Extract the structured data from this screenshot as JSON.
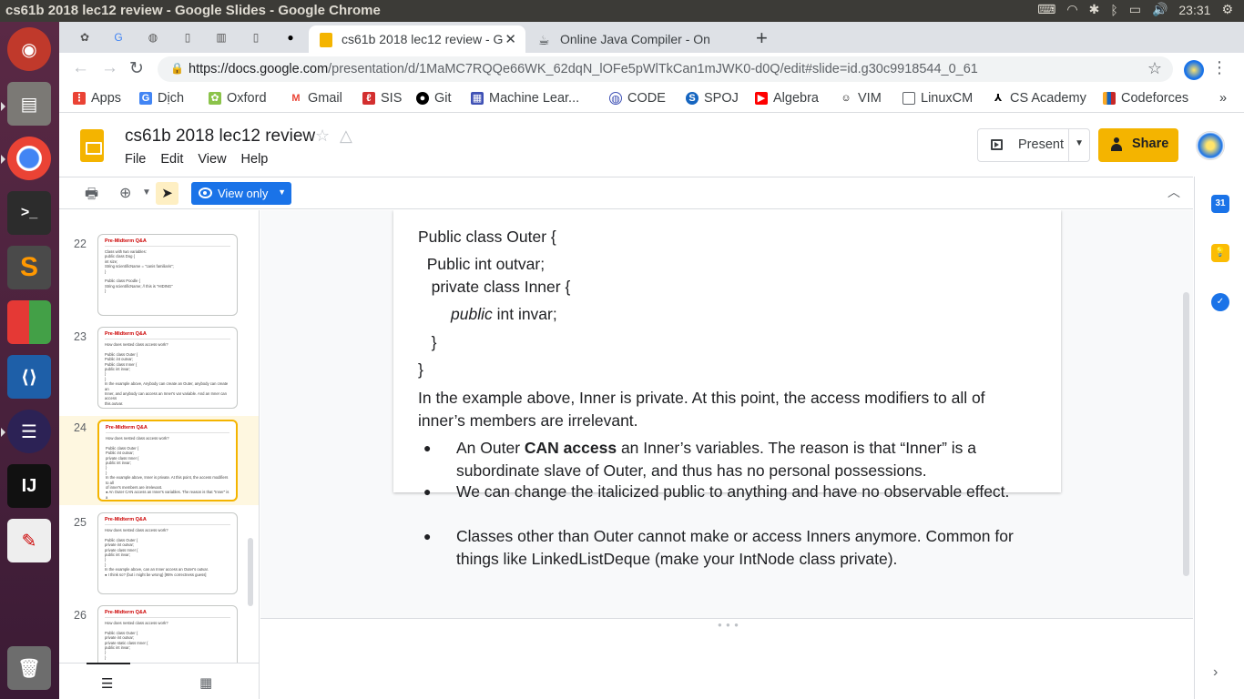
{
  "os": {
    "window_title": "cs61b 2018 lec12 review - Google Slides - Google Chrome",
    "clock": "23:31"
  },
  "browser": {
    "tabs": [
      {
        "label": "cs61b 2018 lec12 review - G",
        "active": true
      },
      {
        "label": "Online Java Compiler - On",
        "active": false
      }
    ],
    "url_host": "https://docs.google.com",
    "url_path": "/presentation/d/1MaMC7RQQe66WK_62dqN_lOFe5pWlTkCan1mJWK0-d0Q/edit#slide=id.g30c9918544_0_61",
    "bookmarks": [
      "Apps",
      "Dịch",
      "Oxford",
      "Gmail",
      "SIS",
      "Git",
      "Machine Lear...",
      "CODE",
      "SPOJ",
      "Algebra",
      "VIM",
      "LinuxCM",
      "CS Academy",
      "Codeforces"
    ],
    "bookmarks_more": "»"
  },
  "slides": {
    "doc_title": "cs61b 2018 lec12 review",
    "menu": [
      "File",
      "Edit",
      "View",
      "Help"
    ],
    "present_label": "Present",
    "share_label": "Share",
    "view_only_label": "View only"
  },
  "filmstrip": [
    {
      "num": "22",
      "title": "Pre-Midterm Q&A",
      "body": "Class with two variables:\npublic class Dog {\n   int size;\n   String scientificName = \"canis familiaris\";\n}\n\nPublic class Poodle {\n   String scientificName; // this is \"HIDING\"\n}"
    },
    {
      "num": "23",
      "title": "Pre-Midterm Q&A",
      "body": "How does nested class access work?\n\nPublic class Outer {\n   Public int outvar;\n   Public class Inner {\n      public int invar;\n   }\n}\nIn the example above, Anybody can create an Outer, anybody can create an\nInner, and anybody can access an Inner's var variable. And an Inner can access\nthis.outvar."
    },
    {
      "num": "24",
      "title": "Pre-Midterm Q&A",
      "body": "How does nested class access work?\n\nPublic class Outer {\n   Public int outvar;\n   private class Inner {\n      public int invar;\n   }\n}\nIn the example above, Inner is private. At this point, the access modifiers to all\nof inner's members are irrelevant.\n  ●  An Outer CAN access an Inner's variables. The reason is that \"Inner\" is a\n     subordinate slave of Outer, and thus has no personal possessions.\n  ●  We can change the italicized public to anything and have no observable"
    },
    {
      "num": "25",
      "title": "Pre-Midterm Q&A",
      "body": "How does nested class access work?\n\nPublic class Outer {\n   private int outvar;\n   private class Inner {\n      public int invar;\n   }\n}\nIn the example above, can an Inner access an Outer's outvar.\n  ●  I think so? (but i might be wrong) [95% correctness guess]"
    },
    {
      "num": "26",
      "title": "Pre-Midterm Q&A",
      "body": "How does nested class access work?\n\nPublic class Outer {\n   private int outvar;\n   private static class Inner {\n      public int invar;\n   }\n}"
    }
  ],
  "slide": {
    "code_lines": [
      "Public class Outer {",
      "  Public int outvar;",
      "   private class Inner {",
      "",
      "   }",
      "}"
    ],
    "code_line4_italic": "public",
    "code_line4_rest": " int invar;",
    "paragraph": "In the example above, Inner is private. At this point, the access modifiers to all of inner’s members are irrelevant.",
    "bullet1_pre": "An Outer ",
    "bullet1_bold": "CAN access",
    "bullet1_post": " an Inner’s variables. The reason is that “Inner” is a subordinate slave of Outer, and thus has no personal possessions.",
    "bullet2": "We can change the italicized public to anything and have no observable effect.",
    "bullet3": "Classes other than Outer cannot make or access Inners anymore. Common for things like LinkedListDeque (make your IntNode class private)."
  }
}
